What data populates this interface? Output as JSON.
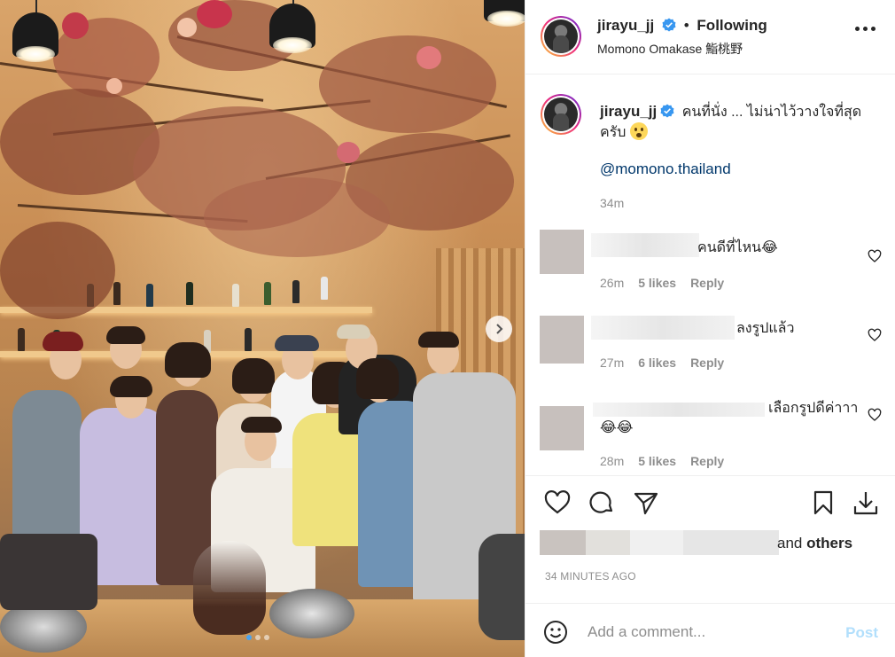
{
  "post": {
    "username": "jirayu_jj",
    "follow_status": "Following",
    "separator": "•",
    "location": "Momono Omakase 鮨桃野",
    "more_icon": "more-horizontal-icon",
    "verified_color": "#3897f0"
  },
  "caption": {
    "username": "jirayu_jj",
    "text": "คนที่นั่ง ... ไม่น่าไว้วางใจที่สุดครับ",
    "mention": "@momono.thailand",
    "time": "34m"
  },
  "comments": [
    {
      "text": "คนดีที่ไหน😂",
      "time": "26m",
      "likes": "5 likes",
      "reply": "Reply"
    },
    {
      "text": "ลงรูปแล้ว",
      "time": "27m",
      "likes": "6 likes",
      "reply": "Reply"
    },
    {
      "text": "เลือกรูปดีค่าาา😂😂",
      "time": "28m",
      "likes": "5 likes",
      "reply": "Reply"
    }
  ],
  "likes": {
    "suffix": "and",
    "others": "others"
  },
  "timestamp": "34 MINUTES AGO",
  "add_comment": {
    "placeholder": "Add a comment...",
    "post_label": "Post"
  },
  "colors": {
    "link": "#00376b",
    "meta": "#8e8e8e",
    "post_disabled": "#b2dffc",
    "carousel_active": "#4aa3f0"
  }
}
